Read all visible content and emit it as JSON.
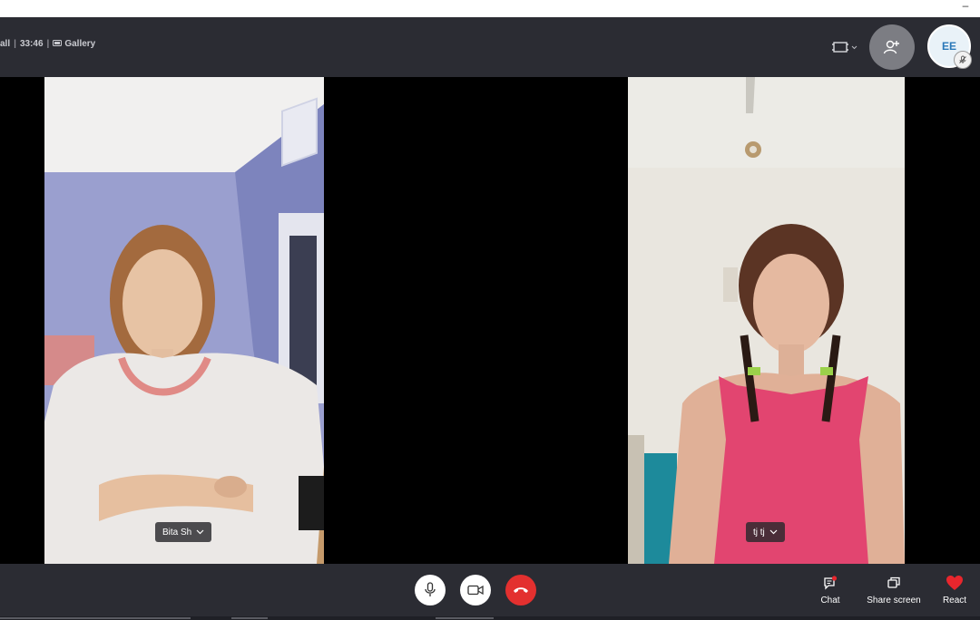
{
  "window": {
    "minimize_glyph": "–"
  },
  "header": {
    "call_prefix": "all",
    "separator": "|",
    "duration": "33:46",
    "view_label": "Gallery",
    "view_icon": "gallery-icon",
    "layout_icon": "layout-toggle-icon",
    "add_people_icon": "add-person-icon",
    "self_avatar_initials": "EE",
    "self_avatar_status_icon": "mic-muted-icon"
  },
  "participants": [
    {
      "name": "Bita Sh",
      "menu_icon": "chevron-down-icon"
    },
    {
      "name": "tj tj",
      "menu_icon": "chevron-down-icon"
    }
  ],
  "controls": {
    "mic_icon": "microphone-icon",
    "video_icon": "video-camera-icon",
    "end_call_icon": "hang-up-icon",
    "chat_label": "Chat",
    "share_screen_label": "Share screen",
    "react_label": "React"
  },
  "colors": {
    "header_bg": "#2b2c33",
    "end_call": "#e3302f",
    "react_heart": "#e8262d",
    "chat_badge": "#e8262d",
    "avatar_text": "#2a78b8"
  }
}
